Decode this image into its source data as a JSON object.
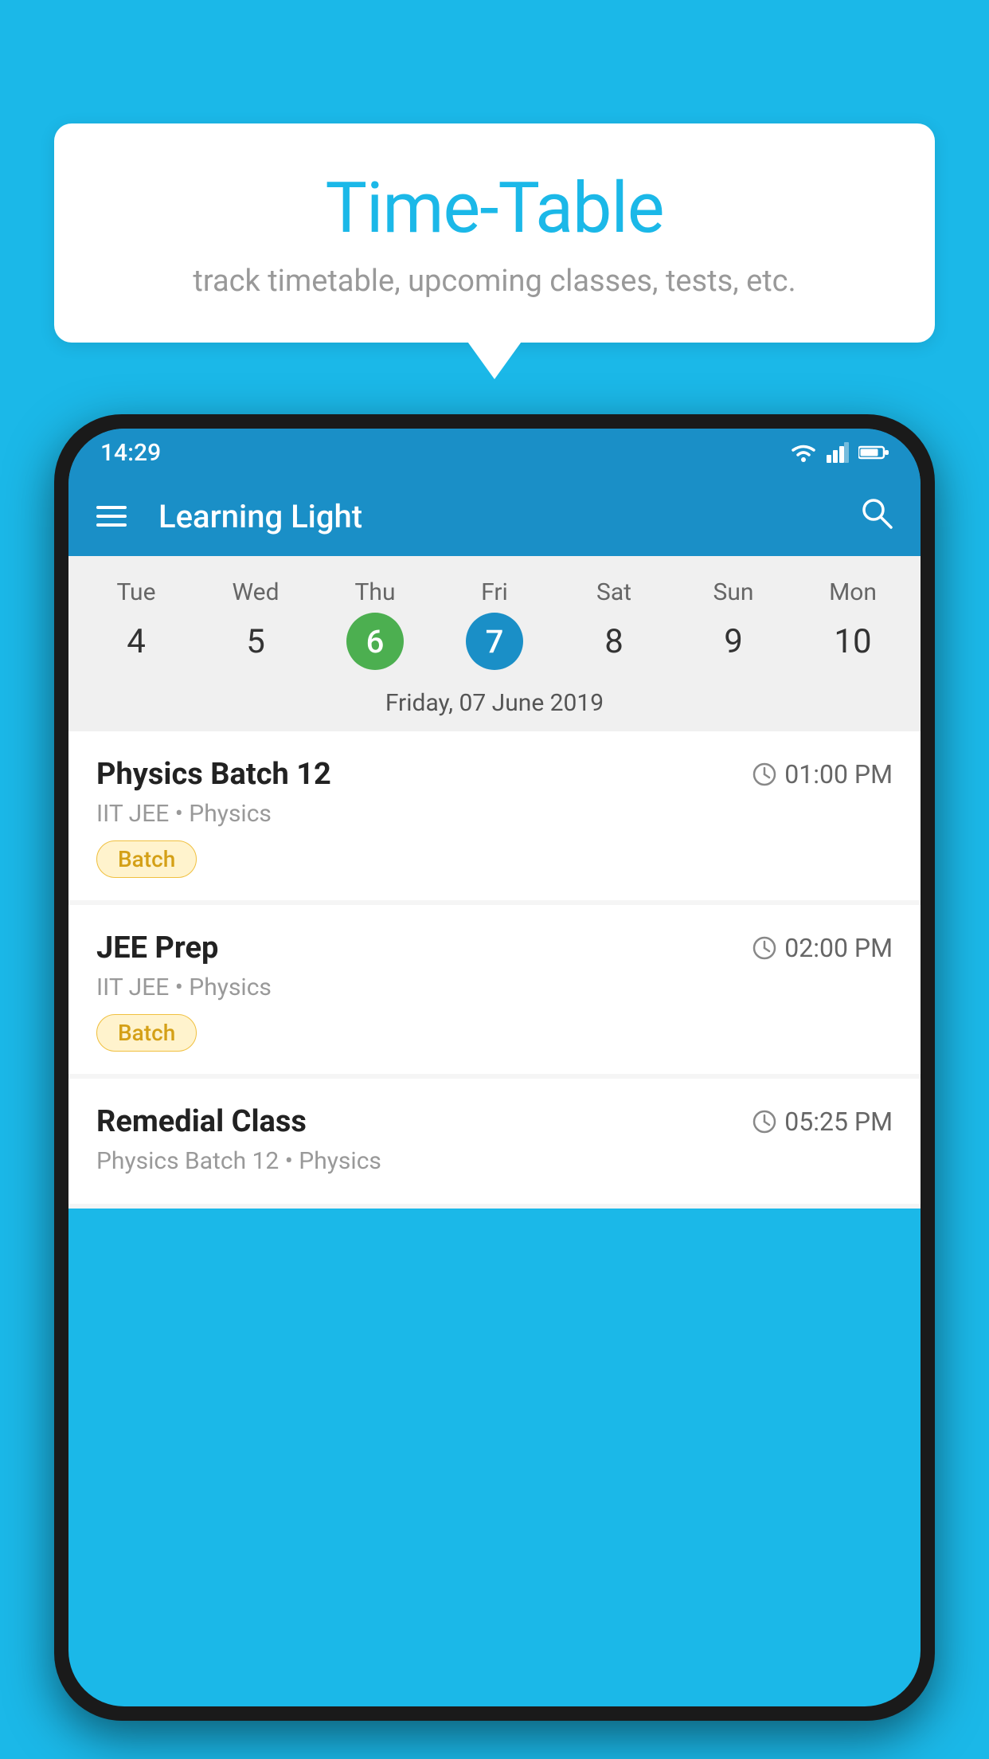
{
  "background_color": "#1BB8E8",
  "bubble": {
    "title": "Time-Table",
    "subtitle": "track timetable, upcoming classes, tests, etc."
  },
  "phone": {
    "status_bar": {
      "time": "14:29"
    },
    "app_bar": {
      "title": "Learning Light"
    },
    "calendar": {
      "days": [
        {
          "label": "Tue",
          "number": "4"
        },
        {
          "label": "Wed",
          "number": "5"
        },
        {
          "label": "Thu",
          "number": "6",
          "style": "green"
        },
        {
          "label": "Fri",
          "number": "7",
          "style": "blue"
        },
        {
          "label": "Sat",
          "number": "8"
        },
        {
          "label": "Sun",
          "number": "9"
        },
        {
          "label": "Mon",
          "number": "10"
        }
      ],
      "selected_date": "Friday, 07 June 2019"
    },
    "schedule": [
      {
        "name": "Physics Batch 12",
        "time": "01:00 PM",
        "meta": "IIT JEE • Physics",
        "badge": "Batch"
      },
      {
        "name": "JEE Prep",
        "time": "02:00 PM",
        "meta": "IIT JEE • Physics",
        "badge": "Batch"
      },
      {
        "name": "Remedial Class",
        "time": "05:25 PM",
        "meta": "Physics Batch 12 • Physics",
        "badge": ""
      }
    ]
  }
}
